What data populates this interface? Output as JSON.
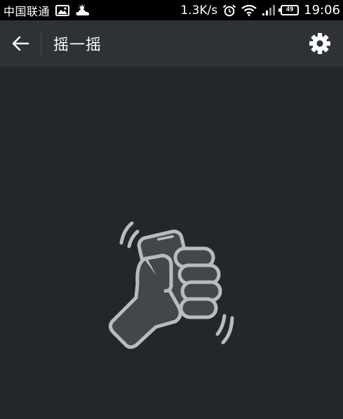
{
  "status_bar": {
    "carrier": "中国联通",
    "net_speed": "1.3K/s",
    "battery_level": "49",
    "time": "19:06",
    "icons": [
      "image-notification-icon",
      "weather-cloud-icon",
      "alarm-clock-icon",
      "wifi-icon",
      "signal-icon",
      "battery-icon"
    ]
  },
  "header": {
    "back_icon": "arrow-left-icon",
    "title": "摇一摇",
    "settings_icon": "gear-icon"
  },
  "main": {
    "illustration": "hand-shaking-phone-icon"
  },
  "colors": {
    "background": "#22272a",
    "header": "#2e3235",
    "status_bar": "#000000",
    "illustration": "#b9bcbe"
  }
}
